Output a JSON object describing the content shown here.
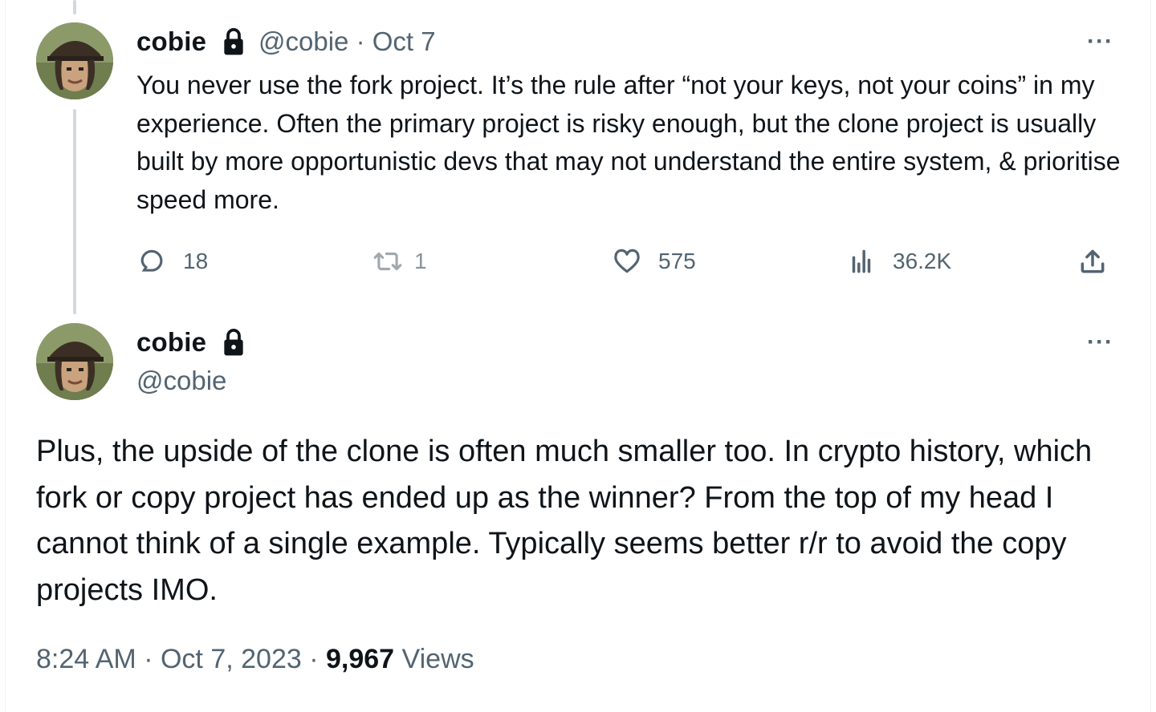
{
  "reply": {
    "author_name": "cobie",
    "handle": "@cobie",
    "separator": "·",
    "date": "Oct 7",
    "more_label": "···",
    "text": "You never use the fork project. It’s the rule after “not your keys, not your coins” in my experience. Often the primary project is risky enough, but the clone project is usually built by more opportunistic devs that may not understand the entire system, & prioritise speed more.",
    "stats": {
      "replies": "18",
      "reposts": "1",
      "likes": "575",
      "views": "36.2K"
    }
  },
  "main": {
    "author_name": "cobie",
    "handle": "@cobie",
    "more_label": "···",
    "text": "Plus, the upside of the clone is often much smaller too. In crypto history, which fork or copy project has ended up as the winner? From the top of my head I cannot think of a single example. Typically seems better r/r to avoid the copy projects IMO.",
    "time": "8:24 AM",
    "separator": "·",
    "date": "Oct 7, 2023",
    "views_count": "9,967",
    "views_label": "Views"
  },
  "colors": {
    "text_primary": "#0f1419",
    "text_secondary": "#536471",
    "thread_line": "#cfd9de"
  },
  "icons": {
    "lock": "lock-icon",
    "reply": "speech-bubble-icon",
    "repost": "repost-arrows-icon",
    "like": "heart-icon",
    "views": "bar-chart-icon",
    "share": "upload-share-icon",
    "more": "ellipsis-icon"
  }
}
